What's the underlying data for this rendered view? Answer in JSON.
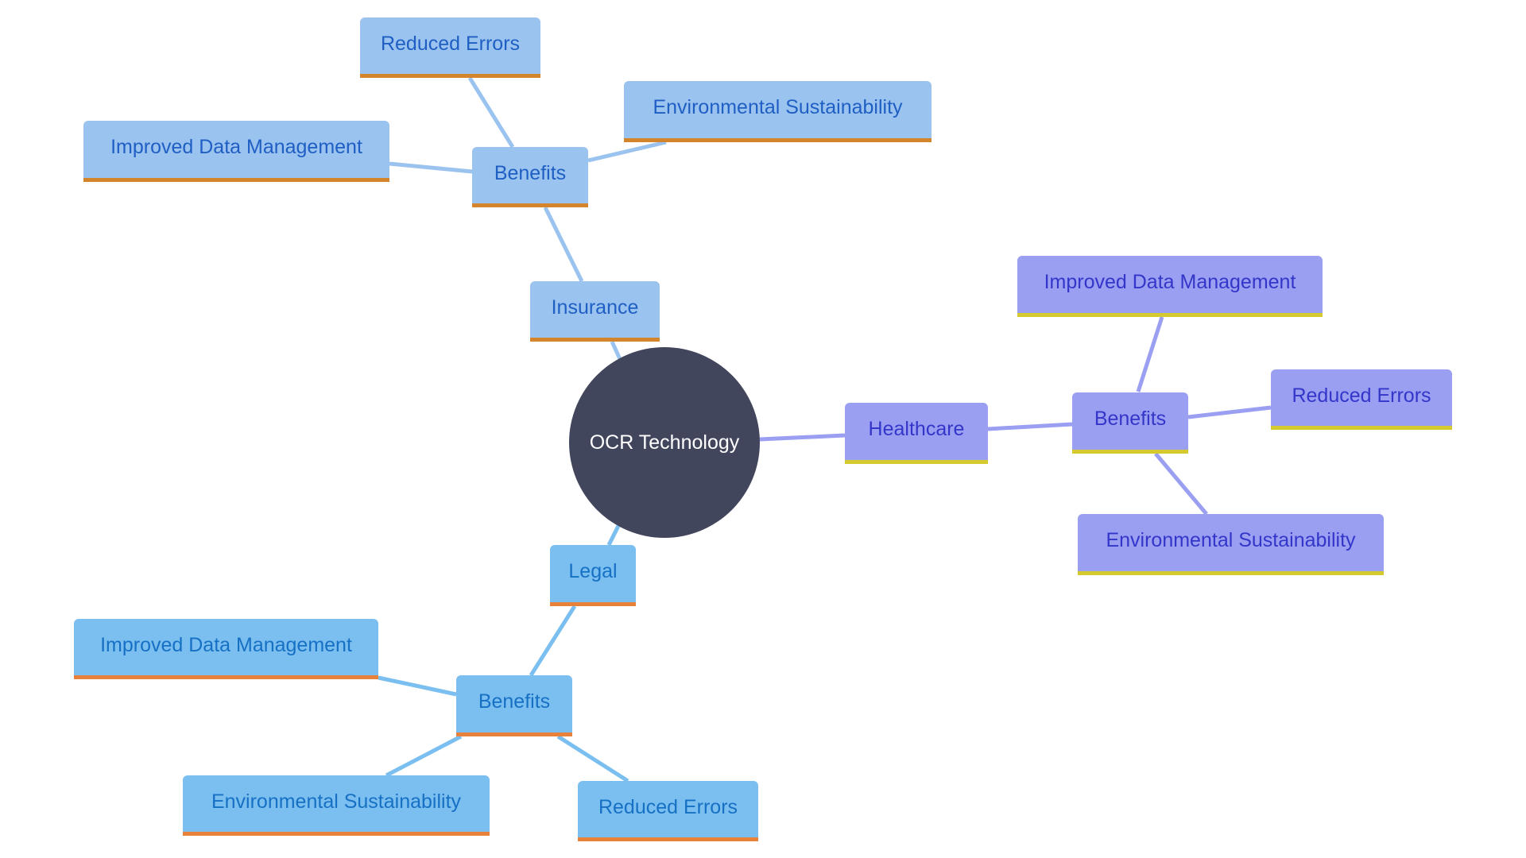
{
  "colors": {
    "root_fill": "#41465d",
    "insurance_fill": "#9bc3ef",
    "insurance_text": "#1f5fc4",
    "insurance_accent": "#d4842a",
    "legal_fill": "#7bbff0",
    "legal_text": "#1670c4",
    "legal_accent": "#e8823a",
    "healthcare_fill": "#9a9ff2",
    "healthcare_text": "#3336c9",
    "healthcare_accent": "#d4c92e"
  },
  "root": {
    "label": "OCR Technology"
  },
  "branches": {
    "insurance": {
      "label": "Insurance",
      "benefits": {
        "label": "Benefits",
        "items": [
          "Reduced Errors",
          "Environmental Sustainability",
          "Improved Data Management"
        ]
      }
    },
    "healthcare": {
      "label": "Healthcare",
      "benefits": {
        "label": "Benefits",
        "items": [
          "Improved Data Management",
          "Reduced Errors",
          "Environmental Sustainability"
        ]
      }
    },
    "legal": {
      "label": "Legal",
      "benefits": {
        "label": "Benefits",
        "items": [
          "Improved Data Management",
          "Environmental Sustainability",
          "Reduced Errors"
        ]
      }
    }
  }
}
